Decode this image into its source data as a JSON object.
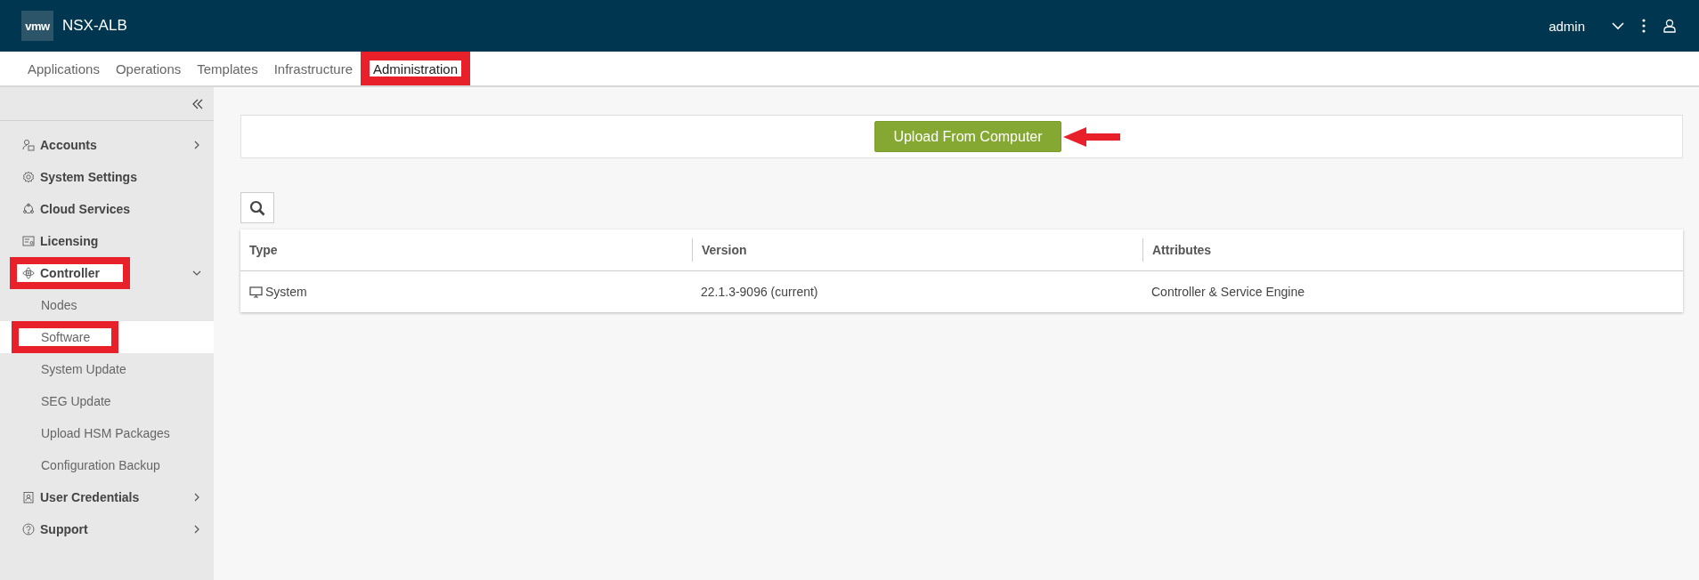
{
  "header": {
    "logo": "vmw",
    "product": "NSX-ALB",
    "user": "admin"
  },
  "tabs": [
    {
      "label": "Applications",
      "selected": false,
      "highlighted": false
    },
    {
      "label": "Operations",
      "selected": false,
      "highlighted": false
    },
    {
      "label": "Templates",
      "selected": false,
      "highlighted": false
    },
    {
      "label": "Infrastructure",
      "selected": false,
      "highlighted": false
    },
    {
      "label": "Administration",
      "selected": true,
      "highlighted": true
    }
  ],
  "sidebar": {
    "items": [
      {
        "label": "Accounts",
        "expanded": false,
        "highlighted": false
      },
      {
        "label": "System Settings",
        "highlighted": false
      },
      {
        "label": "Cloud Services",
        "highlighted": false
      },
      {
        "label": "Licensing",
        "highlighted": false
      },
      {
        "label": "Controller",
        "expanded": true,
        "highlighted": true,
        "children": [
          {
            "label": "Nodes",
            "selected": false,
            "highlighted": false
          },
          {
            "label": "Software",
            "selected": true,
            "highlighted": true
          },
          {
            "label": "System Update",
            "selected": false,
            "highlighted": false
          },
          {
            "label": "SEG Update",
            "selected": false,
            "highlighted": false
          },
          {
            "label": "Upload HSM Packages",
            "selected": false,
            "highlighted": false
          },
          {
            "label": "Configuration Backup",
            "selected": false,
            "highlighted": false
          }
        ]
      },
      {
        "label": "User Credentials",
        "expanded": false,
        "highlighted": false
      },
      {
        "label": "Support",
        "expanded": false,
        "highlighted": false
      }
    ]
  },
  "upload_button": {
    "label": "Upload From Computer",
    "annotation_arrow": true
  },
  "table": {
    "columns": [
      "Type",
      "Version",
      "Attributes"
    ],
    "rows": [
      {
        "type": "System",
        "version": "22.1.3-9096 (current)",
        "attributes": "Controller & Service Engine"
      }
    ]
  }
}
